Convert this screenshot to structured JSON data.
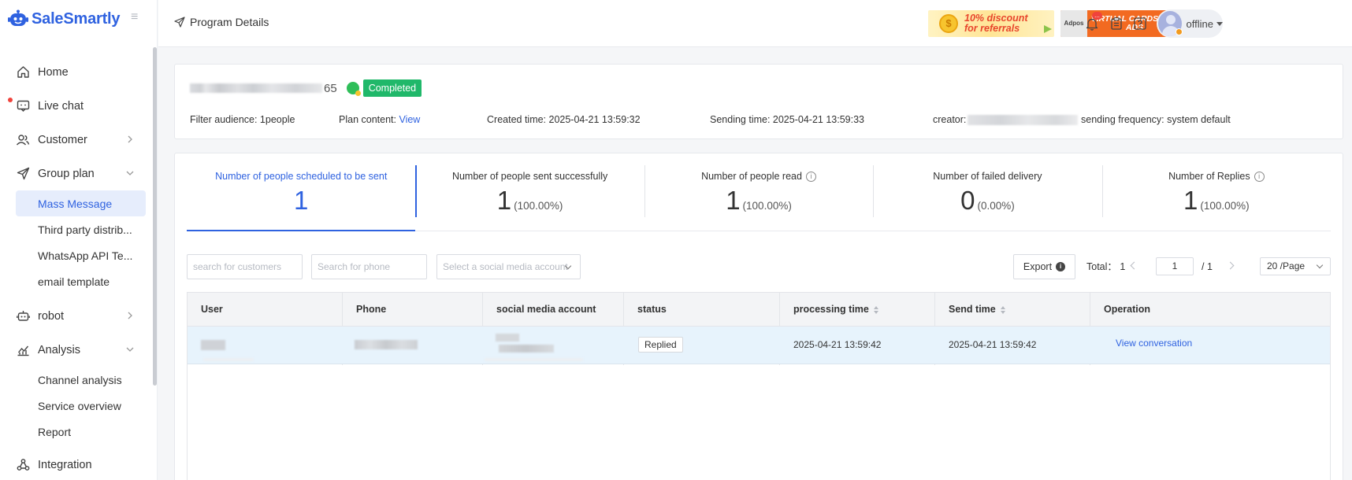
{
  "app": {
    "name": "SaleSmartly"
  },
  "sidebar": {
    "items": [
      {
        "label": "Home",
        "icon": "home-icon"
      },
      {
        "label": "Live chat",
        "icon": "chat-icon",
        "dot": true
      },
      {
        "label": "Customer",
        "icon": "customer-icon",
        "expandable": true
      },
      {
        "label": "Group plan",
        "icon": "send-icon",
        "expanded": true,
        "children": [
          "Mass Message",
          "Third party distrib...",
          "WhatsApp API Te...",
          "email template"
        ]
      },
      {
        "label": "robot",
        "icon": "robot-icon",
        "expandable": true
      },
      {
        "label": "Analysis",
        "icon": "analysis-icon",
        "expanded": true,
        "children": [
          "Channel analysis",
          "Service overview",
          "Report"
        ]
      },
      {
        "label": "Integration",
        "icon": "integration-icon"
      }
    ],
    "active_child": "Mass Message"
  },
  "header": {
    "breadcrumb": "Program Details",
    "promo1": "10% discount for referrals",
    "promo2_brand": "Adpos",
    "promo2": "VIRTUAL CARDS FOR ADS",
    "notification_badge": "...",
    "user_status": "offline"
  },
  "plan": {
    "name_suffix": "65",
    "status": "Completed",
    "filter_audience": "Filter audience: 1people",
    "plan_content_label": "Plan content:",
    "plan_content_link": "View",
    "created_time": "Created time: 2025-04-21 13:59:32",
    "sending_time": "Sending time: 2025-04-21 13:59:33",
    "creator_label": "creator:",
    "frequency": "sending frequency: system default"
  },
  "stats": [
    {
      "title": "Number of people scheduled to be sent",
      "value": "1",
      "pct": ""
    },
    {
      "title": "Number of people sent successfully",
      "value": "1",
      "pct": "(100.00%)"
    },
    {
      "title": "Number of people read",
      "value": "1",
      "pct": "(100.00%)",
      "info": "i"
    },
    {
      "title": "Number of failed delivery",
      "value": "0",
      "pct": "(0.00%)"
    },
    {
      "title": "Number of Replies",
      "value": "1",
      "pct": "(100.00%)",
      "info": "i"
    }
  ],
  "toolbar": {
    "search_customers": "search for customers",
    "search_phone": "Search for phone",
    "social_select": "Select a social media account",
    "export": "Export",
    "export_badge": "i",
    "total": "Total： 1",
    "page_current": "1",
    "page_total": "/  1",
    "page_size": "20 /Page"
  },
  "table": {
    "columns": [
      "User",
      "Phone",
      "social media account",
      "status",
      "processing time",
      "Send time",
      "Operation"
    ],
    "rows": [
      {
        "status": "Replied",
        "processing_time": "2025-04-21 13:59:42",
        "send_time": "2025-04-21 13:59:42",
        "operation": "View conversation"
      }
    ]
  },
  "colors": {
    "accent": "#2f62e0",
    "success": "#20b86a",
    "row_highlight": "#e7f3fc"
  }
}
